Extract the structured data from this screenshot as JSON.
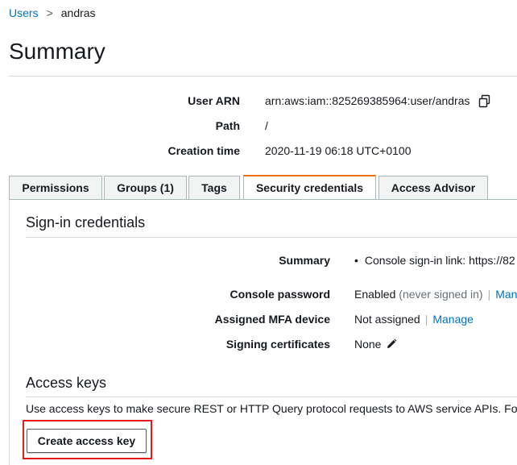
{
  "breadcrumb": {
    "parent": "Users",
    "separator": ">",
    "current": "andras"
  },
  "page": {
    "title": "Summary"
  },
  "summary": {
    "user_arn_label": "User ARN",
    "user_arn_value": "arn:aws:iam::825269385964:user/andras",
    "path_label": "Path",
    "path_value": "/",
    "creation_label": "Creation time",
    "creation_value": "2020-11-19 06:18 UTC+0100"
  },
  "tabs": [
    {
      "label": "Permissions",
      "active": false
    },
    {
      "label": "Groups (1)",
      "active": false
    },
    {
      "label": "Tags",
      "active": false
    },
    {
      "label": "Security credentials",
      "active": true
    },
    {
      "label": "Access Advisor",
      "active": false
    }
  ],
  "signin": {
    "title": "Sign-in credentials",
    "summary_label": "Summary",
    "summary_bullet": "•",
    "summary_value": "Console sign-in link: https://82",
    "console_password_label": "Console password",
    "console_password_value": "Enabled",
    "console_password_note": "(never signed in)",
    "console_password_link": "Man",
    "mfa_label": "Assigned MFA device",
    "mfa_value": "Not assigned",
    "mfa_link": "Manage",
    "signing_label": "Signing certificates",
    "signing_value": "None",
    "pipe": "|"
  },
  "access_keys": {
    "title": "Access keys",
    "description": "Use access keys to make secure REST or HTTP Query protocol requests to AWS service APIs. Fo",
    "create_button": "Create access key"
  },
  "colors": {
    "link": "#0073bb",
    "active_tab_accent": "#ec7211",
    "highlight": "#e21b1b"
  },
  "icons": {
    "copy": "copy-icon",
    "edit": "pencil-icon",
    "bullet": "bullet-icon"
  }
}
